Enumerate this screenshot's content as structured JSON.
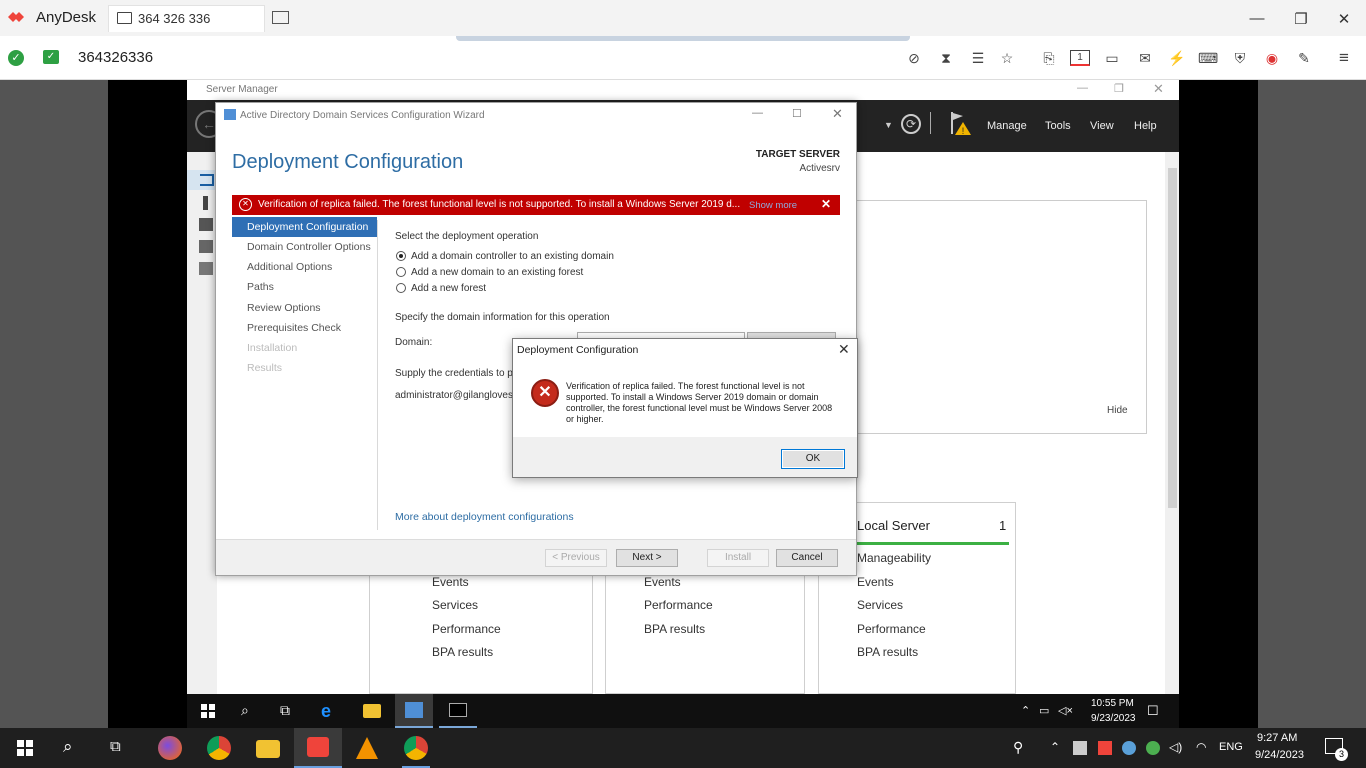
{
  "anydesk": {
    "app_name": "AnyDesk",
    "tab_label": "364 326 336",
    "address": "364326336",
    "win_minimize": "—",
    "win_restore": "❐",
    "win_close": "✕"
  },
  "server_manager": {
    "window_title": "Server Manager",
    "menu": [
      "Manage",
      "Tools",
      "View",
      "Help"
    ],
    "hide_label": "Hide",
    "local_server_tile": {
      "title": "Local Server",
      "count": "1",
      "items": [
        "Manageability",
        "Events",
        "Services",
        "Performance",
        "BPA results"
      ]
    },
    "tile_middle": {
      "items": [
        "Events",
        "Performance",
        "BPA results"
      ]
    },
    "tile_left": {
      "items": [
        "Events",
        "Services",
        "Performance",
        "BPA results"
      ]
    }
  },
  "wizard": {
    "window_title": "Active Directory Domain Services Configuration Wizard",
    "heading": "Deployment Configuration",
    "target_label": "TARGET SERVER",
    "target_name": "Activesrv",
    "error_banner": "Verification of replica failed. The forest functional level is not supported. To install a Windows Server 2019 d...",
    "show_more": "Show more",
    "nav": [
      "Deployment Configuration",
      "Domain Controller Options",
      "Additional Options",
      "Paths",
      "Review Options",
      "Prerequisites Check",
      "Installation",
      "Results"
    ],
    "select_operation": "Select the deployment operation",
    "options": [
      "Add a domain controller to an existing domain",
      "Add a new domain to an existing forest",
      "Add a new forest"
    ],
    "domain_info": "Specify the domain information for this operation",
    "domain_label": "Domain:",
    "credentials_label": "Supply the credentials to p",
    "credentials_value": "administrator@gilangloves",
    "more_link": "More about deployment configurations",
    "btn_previous": "< Previous",
    "btn_next": "Next >",
    "btn_install": "Install",
    "btn_cancel": "Cancel"
  },
  "message_box": {
    "title": "Deployment Configuration",
    "text": "Verification of replica failed. The forest functional level is not supported. To install a Windows Server 2019 domain or domain controller, the forest functional level must be Windows Server 2008 or higher.",
    "ok": "OK"
  },
  "remote_taskbar": {
    "time": "10:55 PM",
    "date": "9/23/2023"
  },
  "host_taskbar": {
    "lang": "ENG",
    "time": "9:27 AM",
    "date": "9/24/2023",
    "notification_count": "3"
  }
}
